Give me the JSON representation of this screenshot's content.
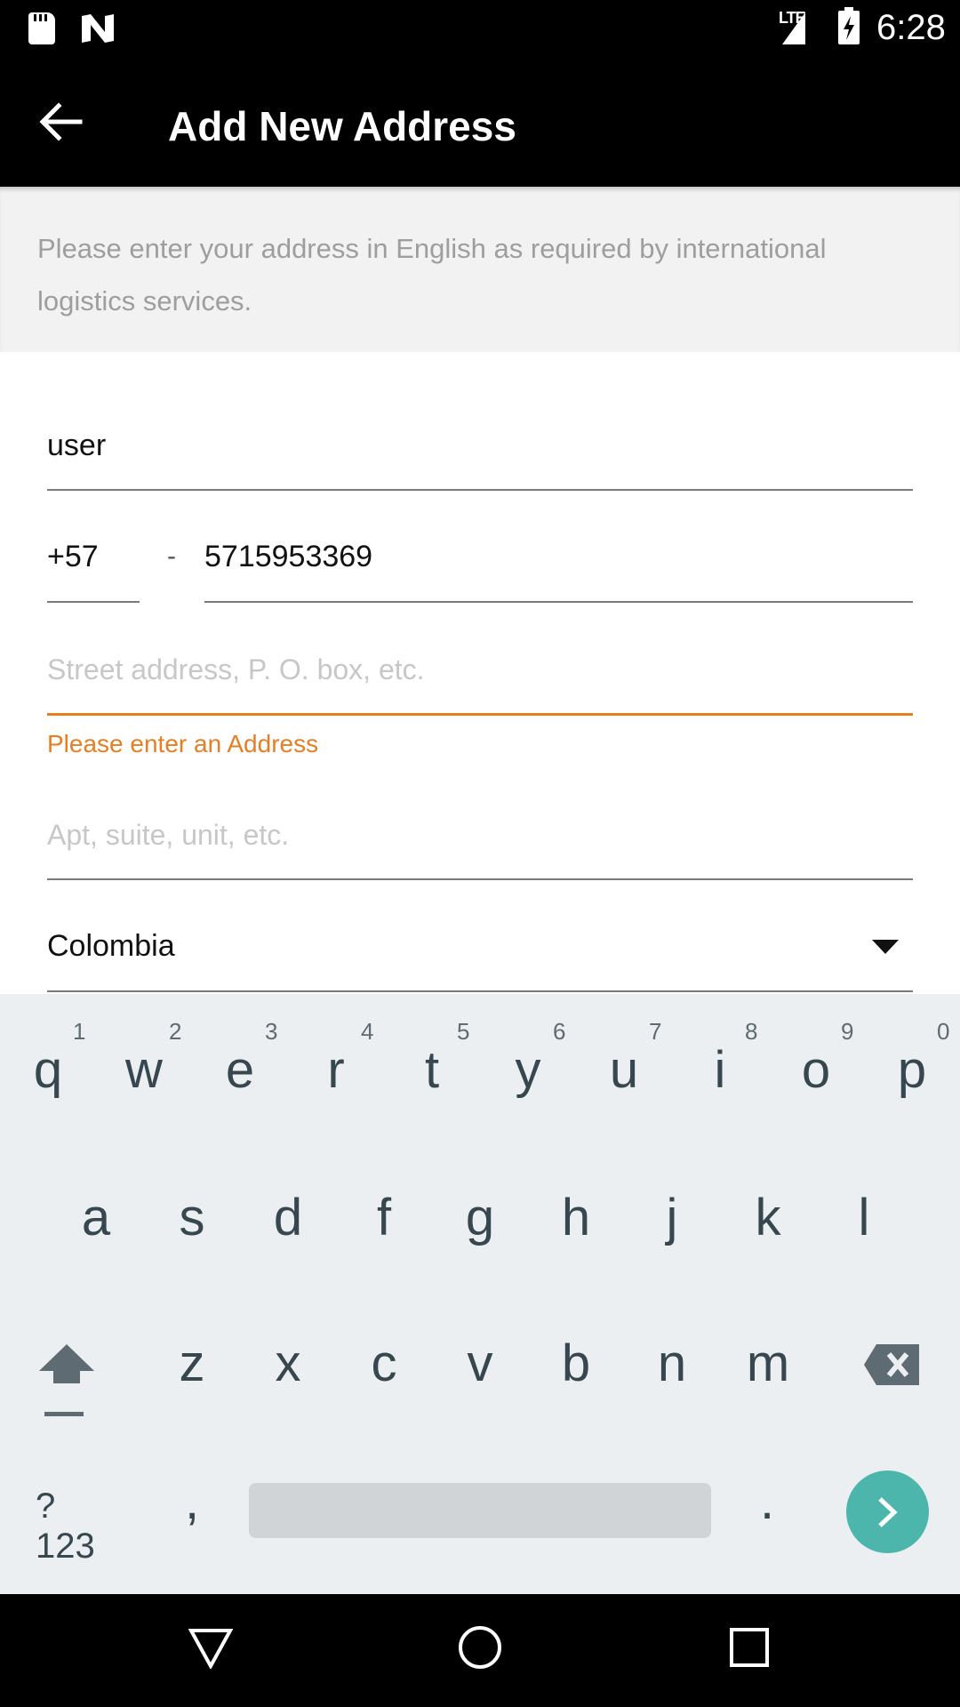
{
  "status_bar": {
    "time": "6:28",
    "network": "LTE",
    "icons": [
      "sd-card-icon",
      "n-logo-icon",
      "signal-icon",
      "battery-charging-icon"
    ]
  },
  "toolbar": {
    "title": "Add New Address",
    "back_icon": "arrow-back-icon"
  },
  "notice": {
    "text": "Please enter your address in English as required by international logistics services."
  },
  "form": {
    "name_value": "user",
    "phone_code": "+57",
    "phone_separator": "-",
    "phone_number": "5715953369",
    "street_placeholder": "Street address, P. O. box, etc.",
    "street_error": "Please enter an Address",
    "apt_placeholder": "Apt, suite, unit, etc.",
    "country_value": "Colombia",
    "error_color": "#e67e22"
  },
  "keyboard": {
    "row1": [
      "q",
      "w",
      "e",
      "r",
      "t",
      "y",
      "u",
      "i",
      "o",
      "p"
    ],
    "row1_hints": [
      "1",
      "2",
      "3",
      "4",
      "5",
      "6",
      "7",
      "8",
      "9",
      "0"
    ],
    "row2": [
      "a",
      "s",
      "d",
      "f",
      "g",
      "h",
      "j",
      "k",
      "l"
    ],
    "row3": [
      "z",
      "x",
      "c",
      "v",
      "b",
      "n",
      "m"
    ],
    "symbols_key": "?123",
    "comma_key": ",",
    "period_key": ".",
    "enter_color": "#4db6ac"
  },
  "nav_bar": {
    "icons": [
      "back-triangle-icon",
      "home-circle-icon",
      "recents-square-icon"
    ]
  }
}
